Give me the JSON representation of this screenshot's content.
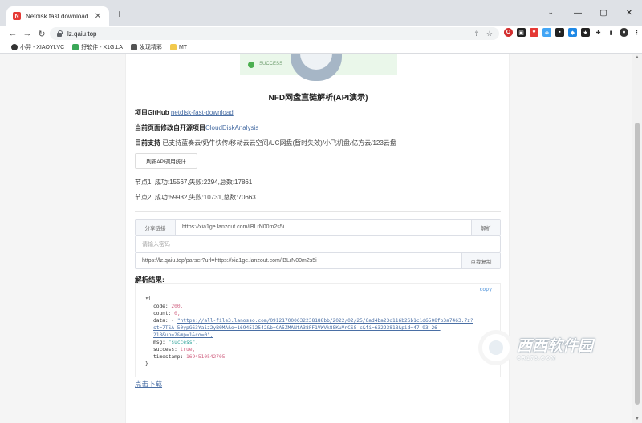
{
  "browser": {
    "tab_title": "Netdisk fast download",
    "tab_close": "✕",
    "new_tab": "+",
    "url": "lz.qaiu.top",
    "win_min": "—",
    "win_max": "▢",
    "win_close": "✕"
  },
  "bookmarks": [
    {
      "label": "小羿 - XIAOYI.VC",
      "color": "#333333"
    },
    {
      "label": "好软件 - X1G.LA",
      "color": "#3aa757"
    },
    {
      "label": "发现精彩",
      "color": "#333333"
    },
    {
      "label": "MT",
      "color": "#f2c94c"
    }
  ],
  "banner": {
    "status": "SUCCESS"
  },
  "page": {
    "title": "NFD网盘直链解析(API演示)",
    "github_label": "项目GitHub",
    "github_link": "netdisk-fast-download",
    "modified_label": "当前页面修改自开源项目",
    "modified_link": "CloudDiskAnalysis",
    "support_label": "目前支持",
    "support_text": "已支持蓝奏云/奶牛快传/移动云云空间/UC网盘(暂时失效)/小飞机盘/亿方云/123云盘",
    "refresh_button": "刷新API调用统计",
    "node1": "节点1: 成功:15567,失败:2294,总数:17861",
    "node2": "节点2: 成功:59932,失败:10731,总数:70663"
  },
  "form": {
    "share_addon": "分享链接",
    "share_value": "https://xia1ge.lanzout.com/iBLrN00m2s5i",
    "parse_button": "解析",
    "password_placeholder": "请输入密码",
    "api_value": "https://lz.qaiu.top/parser?url=https://xia1ge.lanzout.com/iBLrN00m2s5i",
    "copy_button": "点我复制"
  },
  "result": {
    "label": "解析结果:",
    "copy": "copy",
    "open_brace": "▾{",
    "code_key": "code:",
    "code_val": "200,",
    "count_key": "count:",
    "count_val": "0,",
    "data_key": "data:",
    "data_toggle": "▾",
    "data_line1": "\"https://all-file3.lanosso.com/091217000632238188bb/2022/02/25/6ad4ba23d116b26b1c1d6508fb3a7463.7z?",
    "data_line2": "st=7TSA-50ypG63Yaiz2yB0MA&e=1694512542&b=CA5ZMANtA38FF1VWVk88KuVnCS8_c&fi=63223818&pid=47-93-26-",
    "data_line3": "218&up=2&mp=1&co=0\",",
    "msg_key": "msg:",
    "msg_val": "\"success\",",
    "success_key": "success:",
    "success_val": "true,",
    "timestamp_key": "timestamp:",
    "timestamp_val": "1694510542705",
    "close_brace": "}"
  },
  "download_link": "点击下载",
  "watermark": {
    "main": "西西软件园",
    "sub": "CR173.COM"
  }
}
